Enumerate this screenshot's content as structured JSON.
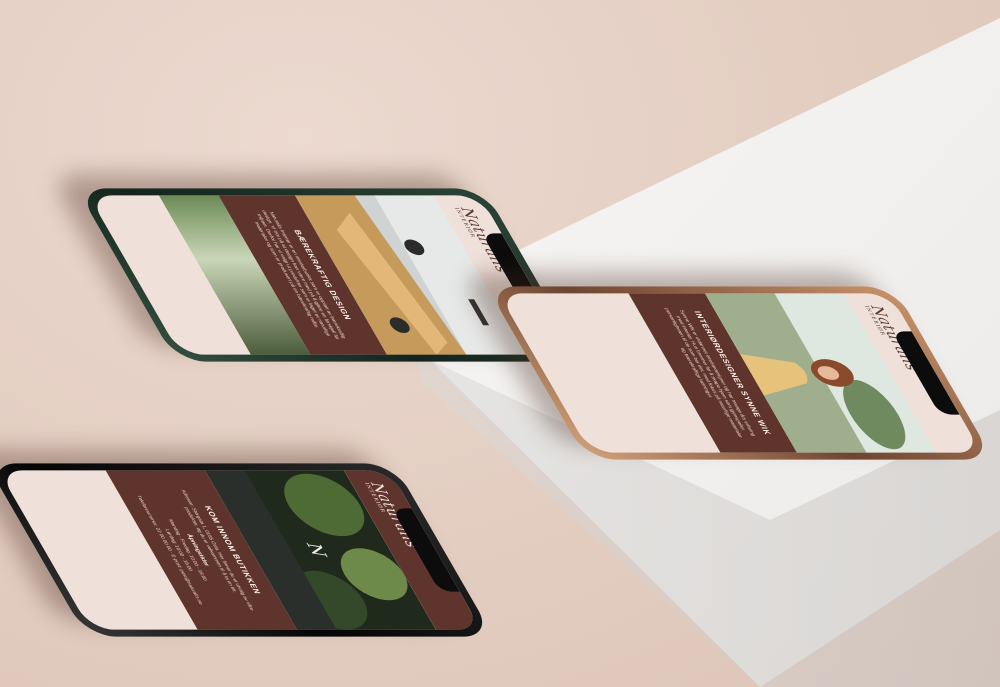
{
  "brand": {
    "logo": "Naturalis",
    "tagline": "INTERIØR"
  },
  "phones": {
    "green": {
      "heading": "BÆREKRAFTIG DESIGN",
      "body": "Naturalis Interiør er en interiørbutikk som er opptatt av bærekraftig design. Vi tror på at design kan være med på å gjøre en forskjell for miljøet. Derfor har vi valgt ut produkter som er laget av naturlige materialer og som er produsert på en bærekraftig måte."
    },
    "gold": {
      "heading": "INTERIØRDESIGNER SYNNE WIK",
      "body": "Synne Wik er utdannet interiørdesigner og har mange års erfaring med interiør. Hun brenner for å skape hjem som gjenspeiler personligheten til de som bor der, med fokus på naturlige materialer og bærekraftige løsninger."
    },
    "black": {
      "heading": "KOM INNOM BUTIKKEN",
      "body": "Adresse: Storgata 1, 0155 Oslo. Her finner du et utvalg av våre produkter, og du er velkommen til å ta en titt.",
      "hours_heading": "Åpningstider",
      "hours_weekdays": "Mandag - Fredag: 10:00 - 18:00",
      "hours_saturday": "Lørdag: 10:00 - 15:00",
      "contact": "Telefonnummer: 22 00 00 00 · E-post: post@naturalis.no"
    }
  },
  "colors": {
    "background": "#e4cfc4",
    "panel": "#5e342d",
    "header": "#efe1da",
    "green_phone": "#1f3329",
    "gold_phone": "#a66f4c",
    "black_phone": "#111111"
  }
}
